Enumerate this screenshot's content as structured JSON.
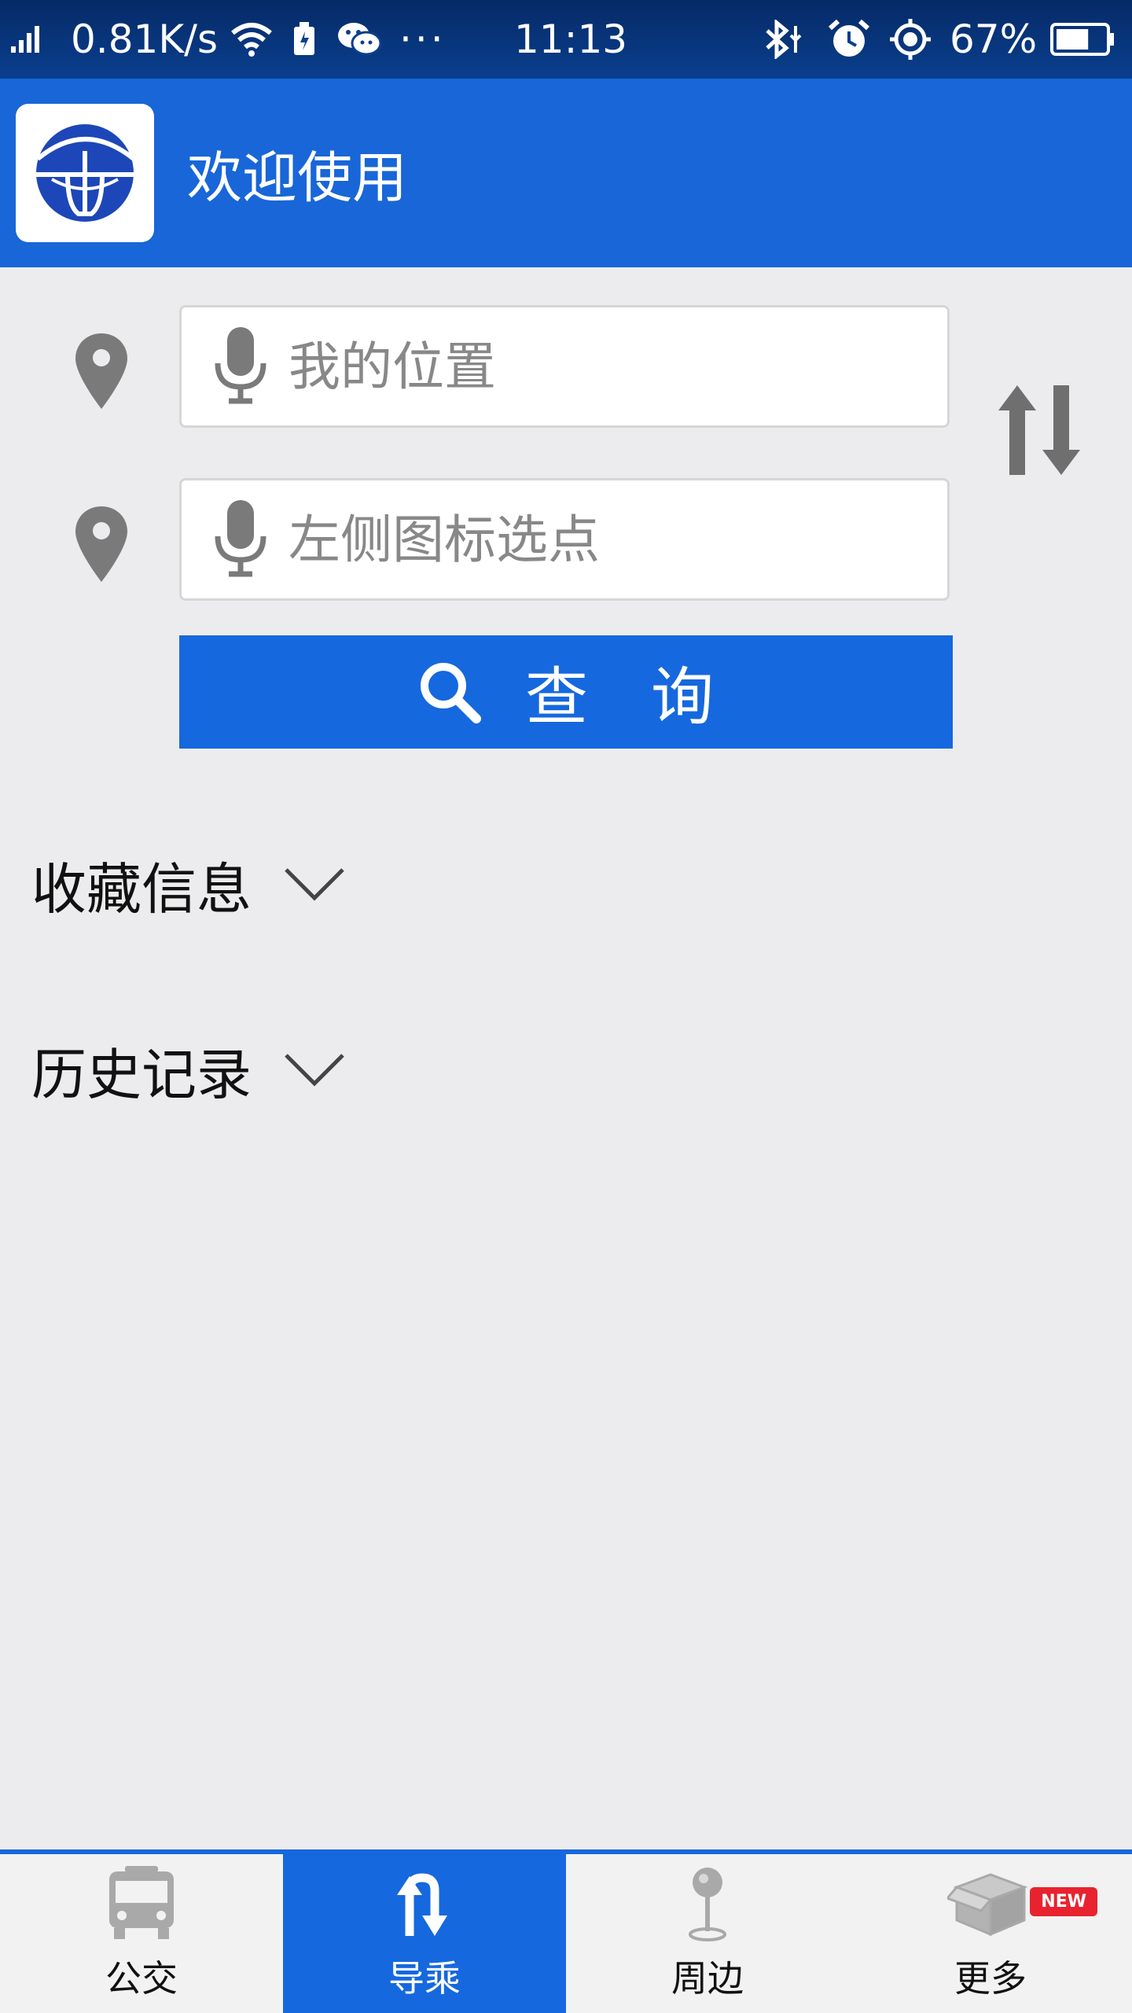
{
  "status_bar": {
    "network_speed": "0.81K/s",
    "dots": "···",
    "time": "11:13",
    "battery_percent": "67%",
    "battery_level": 0.67,
    "icons": [
      "signal-icon",
      "wifi-icon",
      "battery-saver-icon",
      "wechat-icon",
      "bluetooth-icon",
      "alarm-icon",
      "location-icon",
      "battery-icon"
    ]
  },
  "header": {
    "title": "欢迎使用",
    "logo": "app-logo"
  },
  "route_form": {
    "start": {
      "value": "",
      "placeholder": "我的位置"
    },
    "end": {
      "value": "",
      "placeholder": "左侧图标选点"
    },
    "query_label": "查询",
    "accent": "#1668de"
  },
  "sections": {
    "favorites": "收藏信息",
    "history": "历史记录"
  },
  "bottom_nav": {
    "items": [
      {
        "label": "公交",
        "icon": "bus-icon"
      },
      {
        "label": "导乘",
        "icon": "transfer-icon",
        "active": true
      },
      {
        "label": "周边",
        "icon": "map-pin-icon"
      },
      {
        "label": "更多",
        "icon": "box-icon",
        "badge": "NEW"
      }
    ]
  },
  "colors": {
    "primary": "#1866d8",
    "background": "#ececee",
    "badge": "#e8232f"
  }
}
